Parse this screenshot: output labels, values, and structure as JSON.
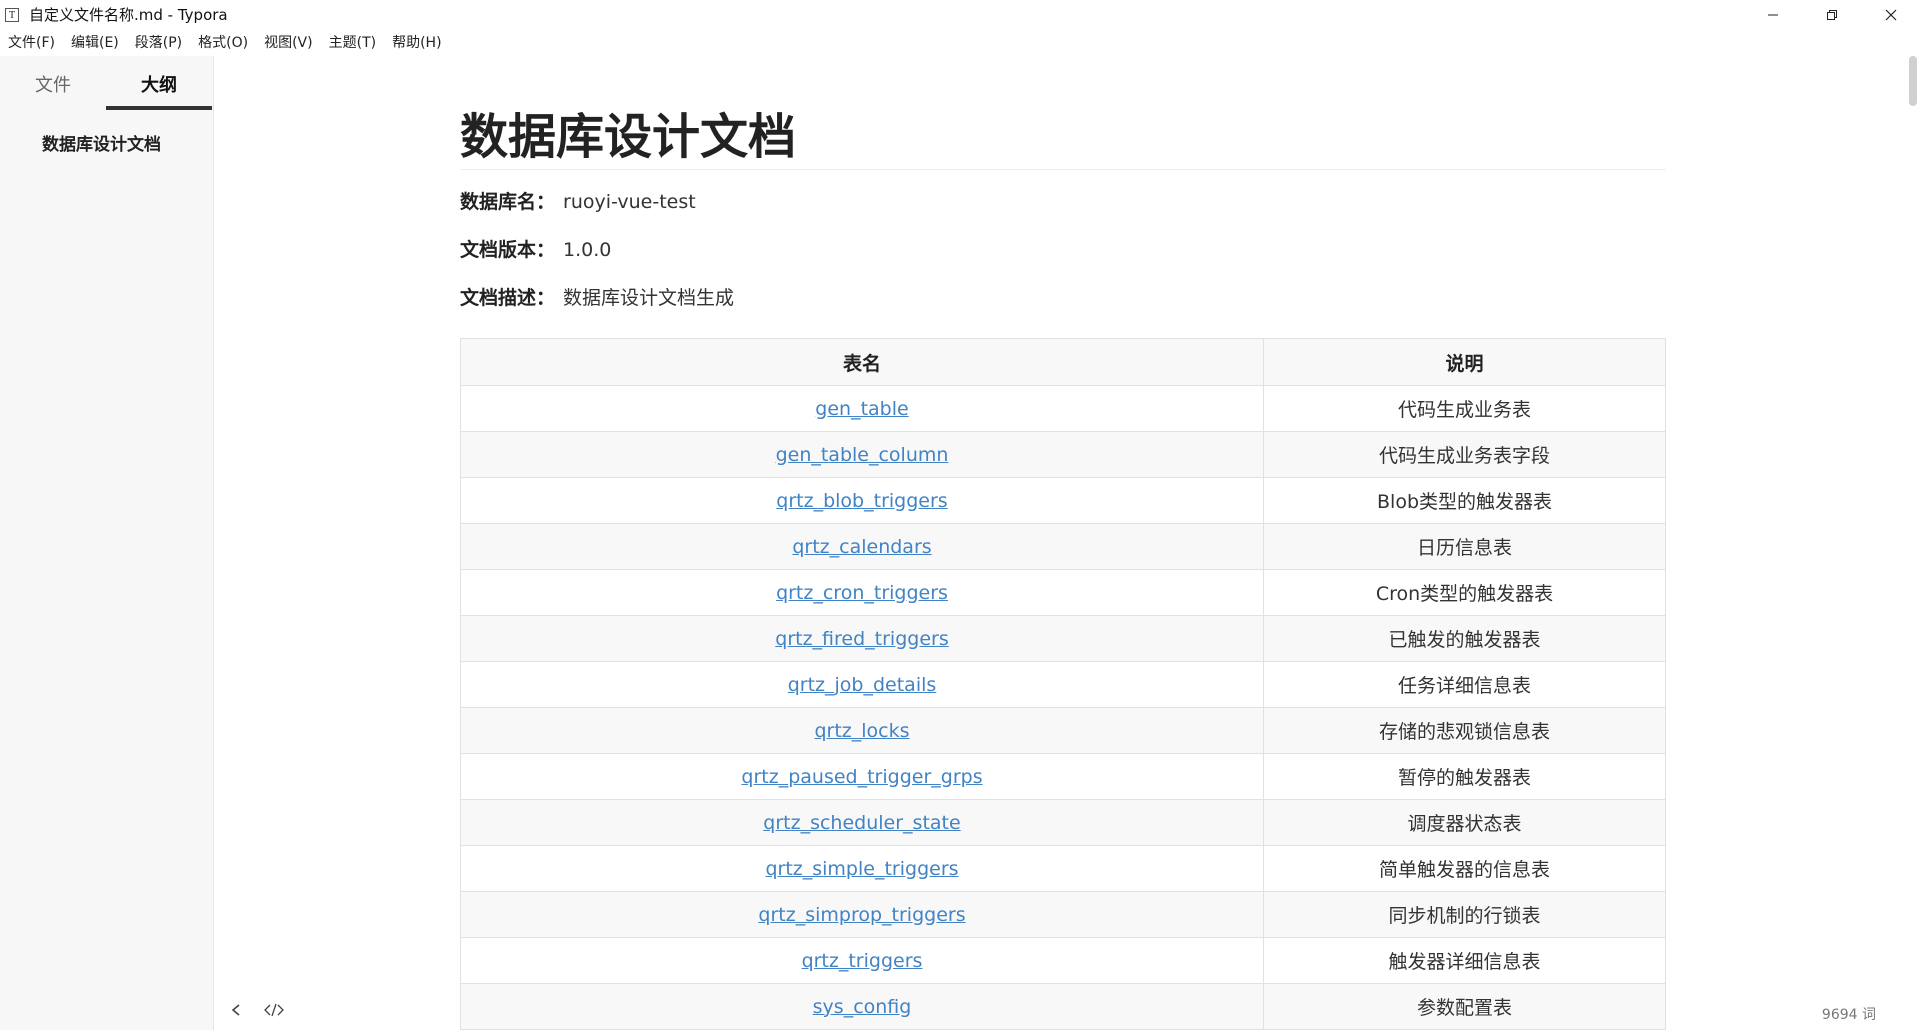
{
  "window": {
    "title": "自定义文件名称.md - Typora",
    "app_icon_letter": "T"
  },
  "menu": [
    "文件(F)",
    "编辑(E)",
    "段落(P)",
    "格式(O)",
    "视图(V)",
    "主题(T)",
    "帮助(H)"
  ],
  "sidebar": {
    "tabs": [
      {
        "label": "文件",
        "active": false
      },
      {
        "label": "大纲",
        "active": true
      }
    ],
    "outline": [
      "数据库设计文档"
    ]
  },
  "document": {
    "title": "数据库设计文档",
    "meta": [
      {
        "label": "数据库名：",
        "value": "ruoyi-vue-test"
      },
      {
        "label": "文档版本：",
        "value": "1.0.0"
      },
      {
        "label": "文档描述：",
        "value": "数据库设计文档生成"
      }
    ],
    "table": {
      "headers": [
        "表名",
        "说明"
      ],
      "rows": [
        [
          "gen_table",
          "代码生成业务表"
        ],
        [
          "gen_table_column",
          "代码生成业务表字段"
        ],
        [
          "qrtz_blob_triggers",
          "Blob类型的触发器表"
        ],
        [
          "qrtz_calendars",
          "日历信息表"
        ],
        [
          "qrtz_cron_triggers",
          "Cron类型的触发器表"
        ],
        [
          "qrtz_fired_triggers",
          "已触发的触发器表"
        ],
        [
          "qrtz_job_details",
          "任务详细信息表"
        ],
        [
          "qrtz_locks",
          "存储的悲观锁信息表"
        ],
        [
          "qrtz_paused_trigger_grps",
          "暂停的触发器表"
        ],
        [
          "qrtz_scheduler_state",
          "调度器状态表"
        ],
        [
          "qrtz_simple_triggers",
          "简单触发器的信息表"
        ],
        [
          "qrtz_simprop_triggers",
          "同步机制的行锁表"
        ],
        [
          "qrtz_triggers",
          "触发器详细信息表"
        ],
        [
          "sys_config",
          "参数配置表"
        ]
      ]
    }
  },
  "status": {
    "word_count": "9694 词"
  },
  "colors": {
    "link": "#4183c4",
    "sidebar_bg": "#f7f7f7",
    "table_border": "#dfe2e5"
  }
}
